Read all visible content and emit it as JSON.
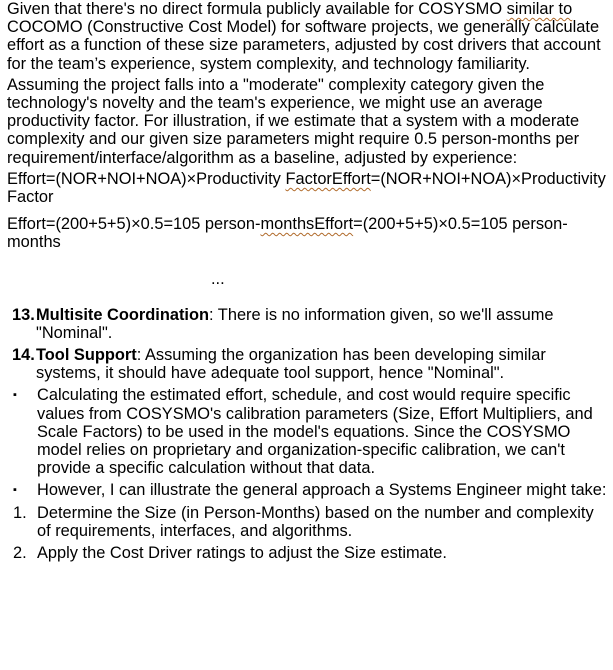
{
  "paragraphs": {
    "p1_a": "Given that there's no direct formula publicly available for COSYSMO ",
    "p1_b": "similar to",
    "p1_c": " COCOMO (Constructive Cost Model) for software projects, we generally calculate effort as a function of these size parameters, adjusted by cost drivers that account for the team’s experience, system complexity, and technology familiarity.",
    "p2": "Assuming the project falls into a \"moderate\" complexity category given the technology's novelty and the team's experience, we might use an average productivity factor. For illustration, if we estimate that a system with a moderate complexity and our given size parameters might require 0.5 person-months per requirement/interface/algorithm as a baseline, adjusted by experience:",
    "p3_a": "Effort=(NOR+NOI+NOA)×Productivity ",
    "p3_b": "FactorEffort",
    "p3_c": "=(NOR+NOI+NOA)×Productivity Factor",
    "p4_a": "Effort=(200+5+5)×0.5=105 person-",
    "p4_b": "monthsEffort",
    "p4_c": "=(200+5+5)×0.5=105 person-months",
    "ellipsis": "..."
  },
  "numbered": [
    {
      "marker": "13.",
      "title": "Multisite Coordination",
      "text": ": There is no information given, so we'll assume \"Nominal\"."
    },
    {
      "marker": "14.",
      "title": "Tool Support",
      "text": ": Assuming the organization has been developing similar systems, it should have adequate tool support, hence \"Nominal\"."
    }
  ],
  "bullets": [
    {
      "marker": "▪",
      "text": "Calculating the estimated effort, schedule, and cost would require specific values from COSYSMO's calibration parameters (Size, Effort Multipliers, and Scale Factors) to be used in the model's equations. Since the COSYSMO model relies on proprietary and organization-specific calibration, we can't provide a specific calculation without that data."
    },
    {
      "marker": "▪",
      "text": "However, I can illustrate the general approach a Systems Engineer might take:"
    }
  ],
  "steps": [
    {
      "marker": "1.",
      "text": "Determine the Size (in Person-Months) based on the number and complexity of requirements, interfaces, and algorithms."
    },
    {
      "marker": "2.",
      "text": "Apply the Cost Driver ratings to adjust the Size estimate."
    }
  ]
}
